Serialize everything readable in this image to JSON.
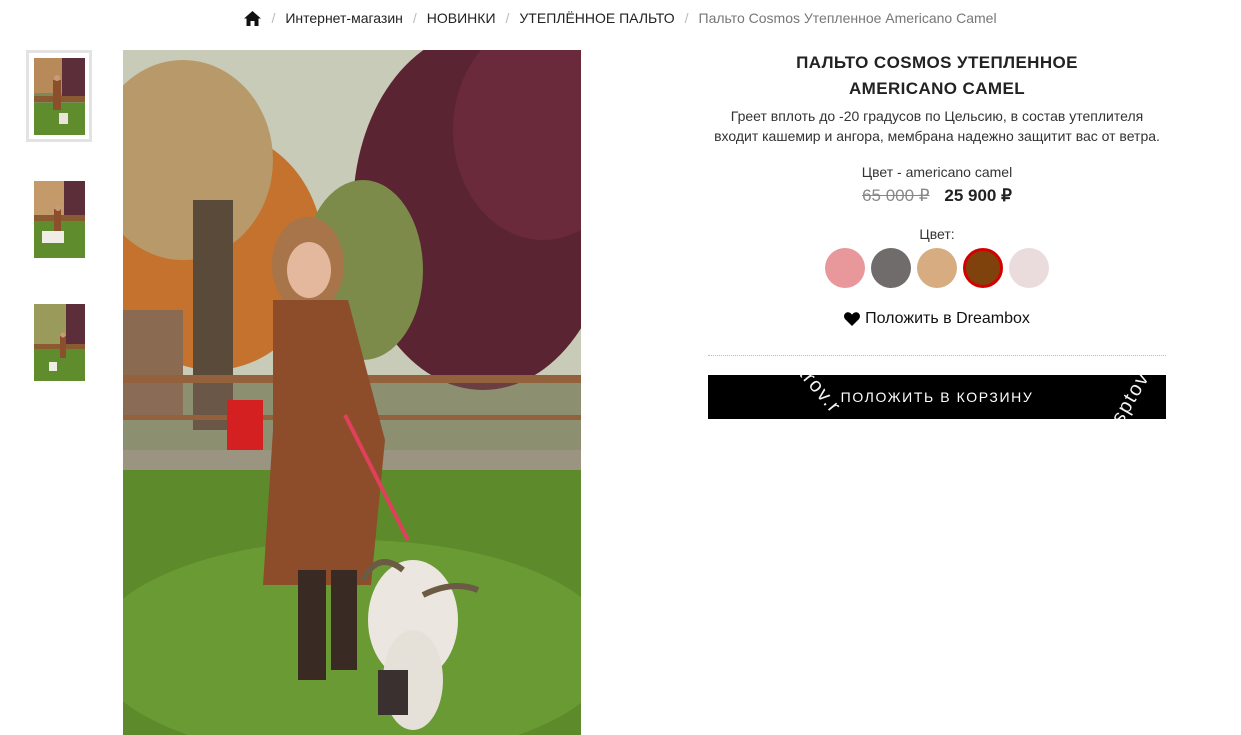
{
  "breadcrumb": {
    "items": [
      "Интернет-магазин",
      "НОВИНКИ",
      "УТЕПЛЁННОЕ ПАЛЬТО"
    ],
    "current": "Пальто Cosmos Утепленное Americano Camel",
    "home_icon": "home-icon",
    "separator": "/"
  },
  "product": {
    "title": "ПАЛЬТО COSMOS УТЕПЛЕННОЕ AMERICANO CAMEL",
    "description": "Греет вплоть до -20 градусов по Цельсию, в состав утеплителя входит кашемир и ангора, мембрана надежно защитит вас от ветра.",
    "color_line": "Цвет - americano camel",
    "old_price": "65 000 ₽",
    "new_price": "25 900 ₽",
    "color_label": "Цвет:",
    "swatches": [
      {
        "color": "#e8979a",
        "selected": false
      },
      {
        "color": "#706c6b",
        "selected": false
      },
      {
        "color": "#d6ac80",
        "selected": false
      },
      {
        "color": "#7f420d",
        "selected": true
      },
      {
        "color": "#eadcdc",
        "selected": false
      }
    ],
    "dreambox_label": "Положить в Dreambox",
    "dreambox_icon": "heart-icon",
    "cart_label": "ПОЛОЖИТЬ В КОРЗИНУ",
    "watermark_left": "arov.r",
    "watermark_right": "sptova"
  },
  "colors": {
    "selected_border": "#d40000",
    "button_bg": "#000000",
    "old_price": "#888888"
  }
}
